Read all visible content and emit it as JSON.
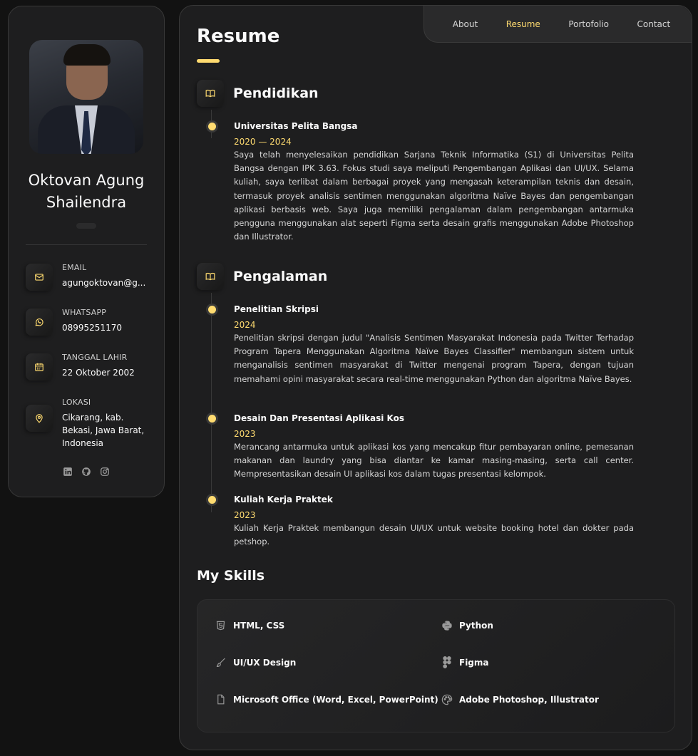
{
  "profile": {
    "name_line1": "Oktovan Agung",
    "name_line2": "Shailendra"
  },
  "contacts": [
    {
      "label": "EMAIL",
      "value": "agungoktovan@g...",
      "icon": "mail-icon"
    },
    {
      "label": "WHATSAPP",
      "value": "08995251170",
      "icon": "whatsapp-icon"
    },
    {
      "label": "TANGGAL LAHIR",
      "value": "22 Oktober 2002",
      "icon": "calendar-icon"
    },
    {
      "label": "LOKASI",
      "value": "Cikarang, kab. Bekasi, Jawa Barat, Indonesia",
      "icon": "location-icon"
    }
  ],
  "socials": [
    "linkedin-icon",
    "github-icon",
    "instagram-icon"
  ],
  "nav": {
    "items": [
      "About",
      "Resume",
      "Portofolio",
      "Contact"
    ],
    "active": "Resume"
  },
  "page": {
    "title": "Resume"
  },
  "education": {
    "heading": "Pendidikan",
    "items": [
      {
        "title": "Universitas Pelita Bangsa",
        "date": "2020 — 2024",
        "text": "Saya telah menyelesaikan pendidikan Sarjana Teknik Informatika (S1) di Universitas Pelita Bangsa dengan IPK 3.63. Fokus studi saya meliputi Pengembangan Aplikasi dan UI/UX. Selama kuliah, saya terlibat dalam berbagai proyek yang mengasah keterampilan teknis dan desain, termasuk proyek analisis sentimen menggunakan algoritma Naïve Bayes dan pengembangan aplikasi berbasis web. Saya juga memiliki pengalaman dalam pengembangan antarmuka pengguna menggunakan alat seperti Figma serta desain grafis menggunakan Adobe Photoshop dan Illustrator."
      }
    ]
  },
  "experience": {
    "heading": "Pengalaman",
    "items": [
      {
        "title": "Penelitian Skripsi",
        "date": "2024",
        "text": "Penelitian skripsi dengan judul \"Analisis Sentimen Masyarakat Indonesia pada Twitter Terhadap Program Tapera Menggunakan Algoritma Naïve Bayes Classifier\" membangun sistem untuk menganalisis sentimen masyarakat di Twitter mengenai program Tapera, dengan tujuan memahami opini masyarakat secara real-time menggunakan Python dan algoritma Naïve Bayes."
      },
      {
        "title": "Desain Dan Presentasi Aplikasi Kos",
        "date": "2023",
        "text": "Merancang antarmuka untuk aplikasi kos yang mencakup fitur pembayaran online, pemesanan makanan dan laundry yang bisa diantar ke kamar masing-masing, serta call center. Mempresentasikan desain UI aplikasi kos dalam tugas presentasi kelompok."
      },
      {
        "title": "Kuliah Kerja Praktek",
        "date": "2023",
        "text": "Kuliah Kerja Praktek membangun desain UI/UX untuk website booking hotel dan dokter pada petshop."
      }
    ]
  },
  "skills": {
    "heading": "My Skills",
    "items": [
      {
        "label": "HTML, CSS",
        "icon": "html5-icon"
      },
      {
        "label": "Python",
        "icon": "python-icon"
      },
      {
        "label": "UI/UX Design",
        "icon": "brush-icon"
      },
      {
        "label": "Figma",
        "icon": "figma-icon"
      },
      {
        "label": "Microsoft Office (Word, Excel, PowerPoint)",
        "icon": "document-icon"
      },
      {
        "label": "Adobe Photoshop, Illustrator",
        "icon": "palette-icon"
      }
    ]
  },
  "colors": {
    "accent": "#ffdb70",
    "panel": "#1e1e1f",
    "background": "#121212"
  }
}
